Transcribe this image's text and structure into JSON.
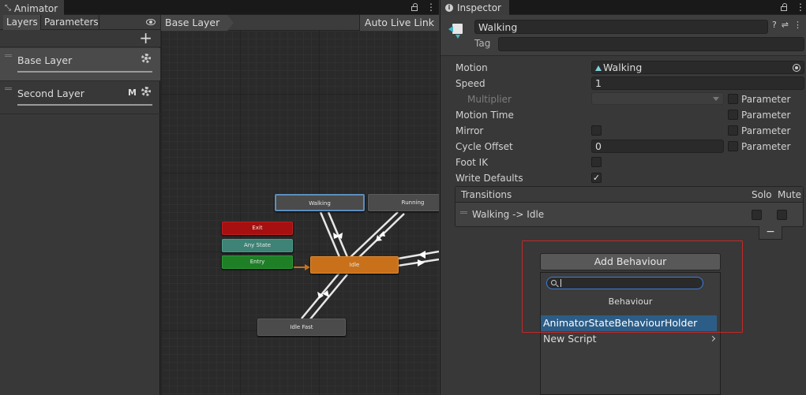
{
  "animator": {
    "window_title": "Animator",
    "tabs": [
      "Layers",
      "Parameters"
    ],
    "layers": [
      {
        "name": "Base Layer",
        "badge": ""
      },
      {
        "name": "Second Layer",
        "badge": "M"
      }
    ],
    "breadcrumb": "Base Layer",
    "auto_live_link": "Auto Live Link",
    "states": {
      "walking": "Walking",
      "running": "Running",
      "exit": "Exit",
      "any_state": "Any State",
      "entry": "Entry",
      "idle": "Idle",
      "idle_fast": "Idle Fast"
    },
    "colors": {
      "exit": "#a61010",
      "any_state": "#3d8376",
      "entry": "#1f7f27",
      "default_state": "#c8701a",
      "selected_outline": "#5d8ebd"
    }
  },
  "inspector": {
    "window_title": "Inspector",
    "name_value": "Walking",
    "tag_label": "Tag",
    "tag_value": "",
    "fields": {
      "motion_label": "Motion",
      "motion_value": "Walking",
      "speed_label": "Speed",
      "speed_value": "1",
      "multiplier_label": "Multiplier",
      "motion_time_label": "Motion Time",
      "mirror_label": "Mirror",
      "cycle_offset_label": "Cycle Offset",
      "cycle_offset_value": "0",
      "foot_ik_label": "Foot IK",
      "write_defaults_label": "Write Defaults",
      "parameter_label": "Parameter"
    },
    "checks": {
      "mirror": false,
      "foot_ik": false,
      "write_defaults": true
    },
    "transitions": {
      "title": "Transitions",
      "solo_label": "Solo",
      "mute_label": "Mute",
      "rows": [
        {
          "name": "Walking -> Idle",
          "solo": false,
          "mute": false
        }
      ],
      "remove_label": "−"
    },
    "add_behaviour": {
      "button_label": "Add Behaviour",
      "search_value": "",
      "header": "Behaviour",
      "items": [
        {
          "label": "AnimatorStateBehaviourHolder",
          "selected": true
        },
        {
          "label": "New Script",
          "submenu": true
        }
      ]
    },
    "highlight_color": "#c32828"
  }
}
